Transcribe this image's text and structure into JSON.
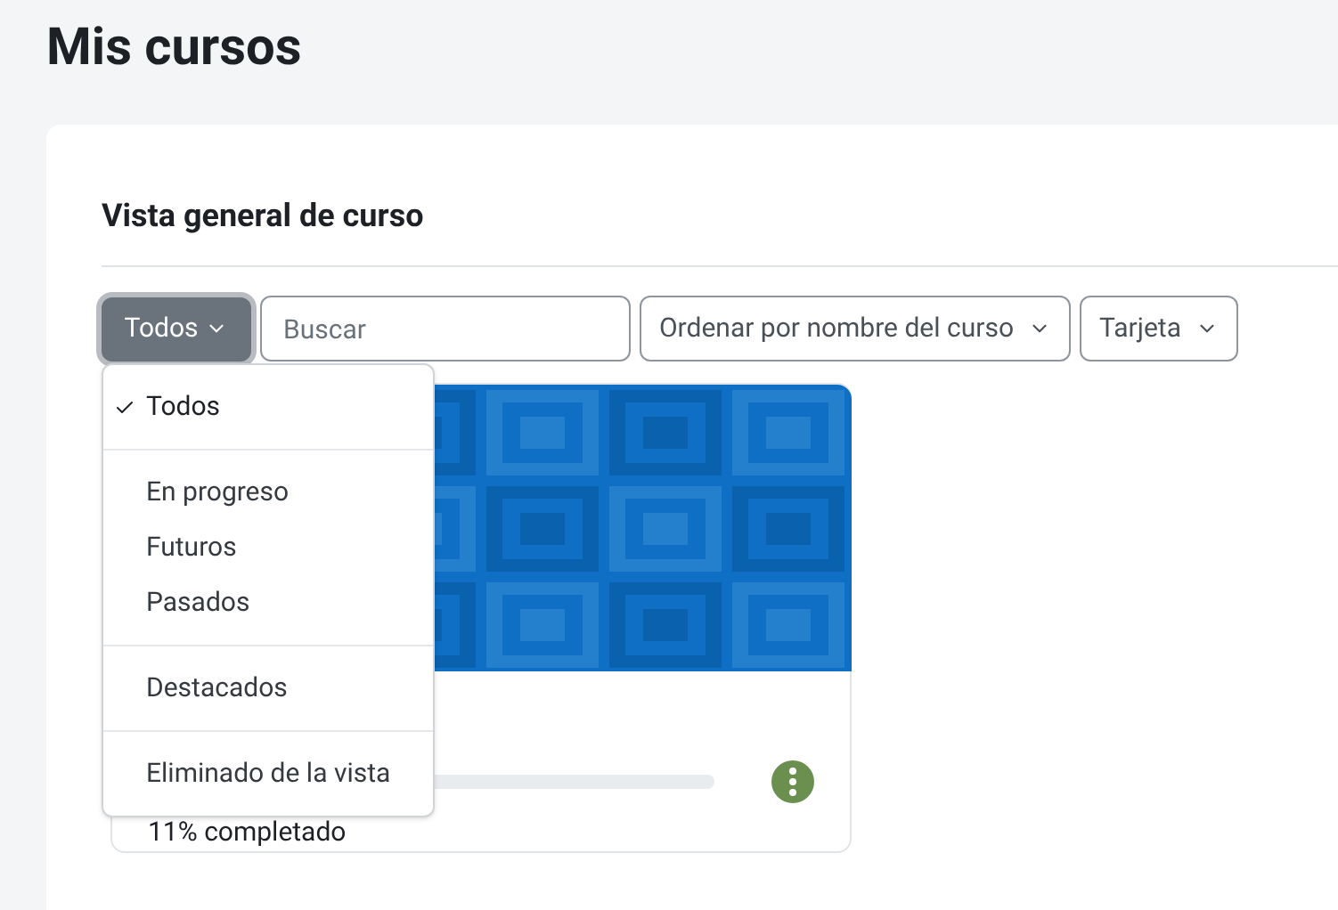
{
  "page_title": "Mis cursos",
  "section_title": "Vista general de curso",
  "filter_button": {
    "label": "Todos"
  },
  "search": {
    "placeholder": "Buscar"
  },
  "sort_select": {
    "label": "Ordenar por nombre del curso"
  },
  "view_select": {
    "label": "Tarjeta"
  },
  "filter_menu": {
    "groups": [
      [
        {
          "label": "Todos",
          "selected": true
        }
      ],
      [
        {
          "label": "En progreso",
          "selected": false
        },
        {
          "label": "Futuros",
          "selected": false
        },
        {
          "label": "Pasados",
          "selected": false
        }
      ],
      [
        {
          "label": "Destacados",
          "selected": false
        }
      ],
      [
        {
          "label": "Eliminado de la vista",
          "selected": false
        }
      ]
    ]
  },
  "course_card": {
    "progress_text": "11% completado"
  }
}
